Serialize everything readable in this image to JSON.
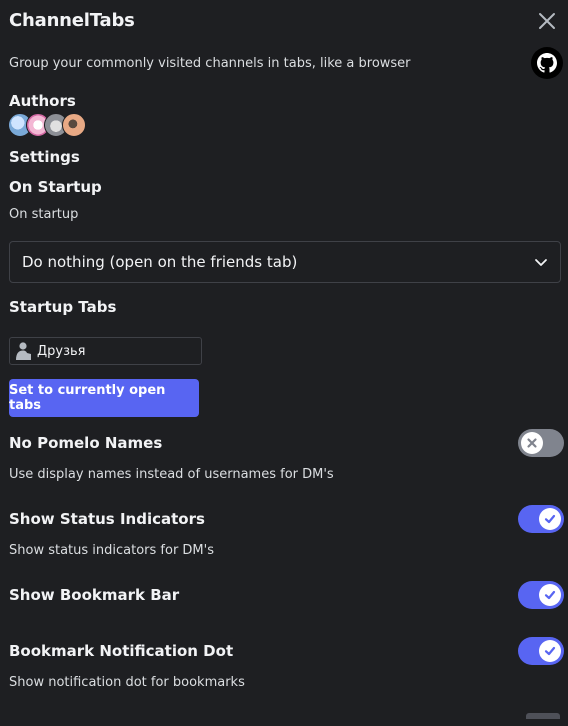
{
  "header": {
    "title": "ChannelTabs",
    "description": "Group your commonly visited channels in tabs, like a browser"
  },
  "authors": {
    "label": "Authors",
    "avatar_colors": [
      "#7aa9d8",
      "#f3b7d4",
      "#8c8f96",
      "#e8a985"
    ]
  },
  "settings": {
    "label": "Settings",
    "on_startup": {
      "title": "On Startup",
      "description": "On startup",
      "selected": "Do nothing (open on the friends tab)"
    },
    "startup_tabs": {
      "title": "Startup Tabs",
      "tab_label": "Друзья",
      "button_label": "Set to currently open tabs"
    },
    "toggles": [
      {
        "title": "No Pomelo Names",
        "description": "Use display names instead of usernames for DM's",
        "enabled": false
      },
      {
        "title": "Show Status Indicators",
        "description": "Show status indicators for DM's",
        "enabled": true
      },
      {
        "title": "Show Bookmark Bar",
        "description": "",
        "enabled": true
      },
      {
        "title": "Bookmark Notification Dot",
        "description": "Show notification dot for bookmarks",
        "enabled": true
      }
    ]
  },
  "colors": {
    "accent": "#5865f2",
    "toggle_off": "#80848e",
    "background": "#1e1f22"
  },
  "icons": {
    "close": "close-icon",
    "github": "github-icon",
    "dropdown": "chevron-down-icon",
    "tab": "friends-icon"
  }
}
